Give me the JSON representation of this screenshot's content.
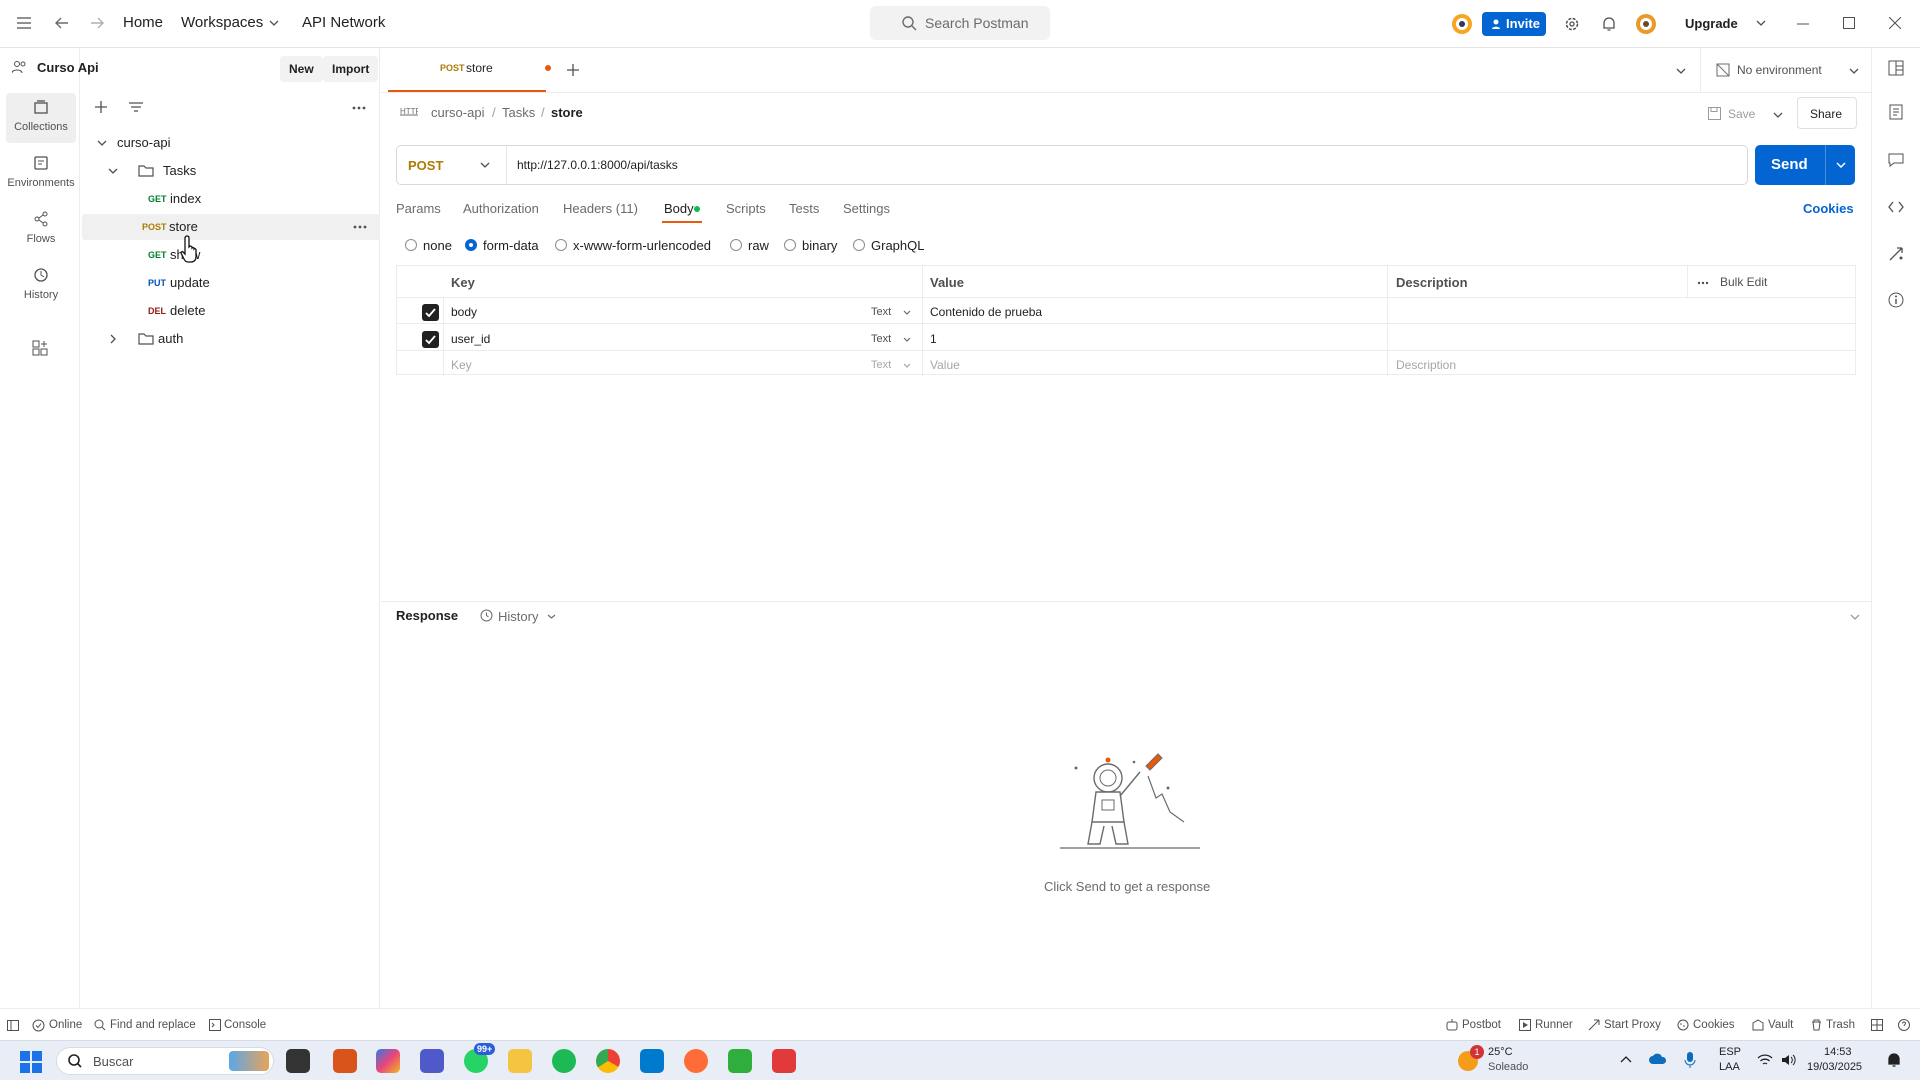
{
  "titlebar": {
    "home": "Home",
    "workspaces": "Workspaces",
    "api_network": "API Network",
    "search_placeholder": "Search Postman",
    "invite": "Invite",
    "upgrade": "Upgrade"
  },
  "rail": {
    "collections": "Collections",
    "environments": "Environments",
    "flows": "Flows",
    "history": "History"
  },
  "sidebar": {
    "workspace_name": "Curso Api",
    "new_btn": "New",
    "import_btn": "Import",
    "collection": "curso-api",
    "folder_tasks": "Tasks",
    "folder_auth": "auth",
    "requests": [
      {
        "method": "GET",
        "name": "index"
      },
      {
        "method": "POST",
        "name": "store"
      },
      {
        "method": "GET",
        "name": "show"
      },
      {
        "method": "PUT",
        "name": "update"
      },
      {
        "method": "DEL",
        "name": "delete"
      }
    ]
  },
  "tab": {
    "method": "POST",
    "name": "store"
  },
  "environment": "No environment",
  "breadcrumb": {
    "collection": "curso-api",
    "folder": "Tasks",
    "request": "store"
  },
  "actions": {
    "save": "Save",
    "share": "Share"
  },
  "request": {
    "method": "POST",
    "url": "http://127.0.0.1:8000/api/tasks",
    "send": "Send"
  },
  "subtabs": {
    "params": "Params",
    "authorization": "Authorization",
    "headers": "Headers (11)",
    "body": "Body",
    "scripts": "Scripts",
    "tests": "Tests",
    "settings": "Settings",
    "cookies": "Cookies"
  },
  "body_types": {
    "none": "none",
    "form_data": "form-data",
    "urlencoded": "x-www-form-urlencoded",
    "raw": "raw",
    "binary": "binary",
    "graphql": "GraphQL"
  },
  "table": {
    "col_key": "Key",
    "col_value": "Value",
    "col_description": "Description",
    "bulk_edit": "Bulk Edit",
    "rows": [
      {
        "key": "body",
        "type": "Text",
        "value": "Contenido de prueba"
      },
      {
        "key": "user_id",
        "type": "Text",
        "value": "1"
      }
    ],
    "placeholder_key": "Key",
    "placeholder_type": "Text",
    "placeholder_value": "Value",
    "placeholder_description": "Description"
  },
  "response": {
    "label": "Response",
    "history": "History",
    "empty_text": "Click Send to get a response"
  },
  "statusbar": {
    "online": "Online",
    "find_replace": "Find and replace",
    "console": "Console",
    "postbot": "Postbot",
    "runner": "Runner",
    "start_proxy": "Start Proxy",
    "cookies": "Cookies",
    "vault": "Vault",
    "trash": "Trash"
  },
  "taskbar": {
    "search": "Buscar",
    "whatsapp_badge": "99+",
    "weather_badge": "1",
    "temp": "25°C",
    "weather": "Soleado",
    "lang1": "ESP",
    "lang2": "LAA",
    "time": "14:53",
    "date": "19/03/2025"
  },
  "colors": {
    "accent": "#0265d2",
    "post": "#ad7a03",
    "get": "#007f31",
    "put": "#0053b8",
    "del": "#8e1a10",
    "body_dot": "#0cbb52",
    "tab_dot": "#e8590c"
  }
}
